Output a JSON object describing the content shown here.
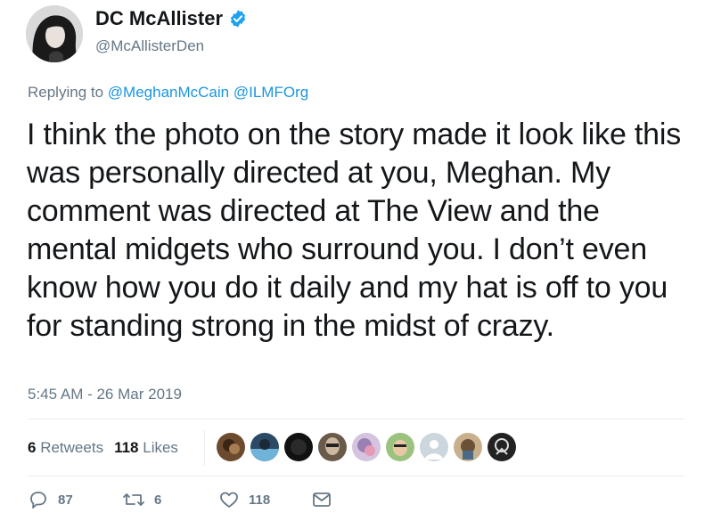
{
  "author": {
    "display_name": "DC McAllister",
    "handle": "@McAllisterDen",
    "verified": true
  },
  "reply": {
    "prefix": "Replying to",
    "mentions": [
      "@MeghanMcCain",
      "@ILMFOrg"
    ]
  },
  "tweet": {
    "text": "I think the photo on the story made it look like this was personally directed at you, Meghan. My comment was directed at The View and the mental midgets who surround you. I don’t even know how you do it daily and my hat is off to you for standing strong in the midst of crazy.",
    "timestamp": "5:45 AM - 26 Mar 2019"
  },
  "stats": {
    "retweets_count": "6",
    "retweets_label": "Retweets",
    "likes_count": "118",
    "likes_label": "Likes"
  },
  "liker_avatars": [
    {
      "icon": "liker-avatar-1",
      "color": "#6b4a2e"
    },
    {
      "icon": "liker-avatar-2",
      "color": "#4a7fa8"
    },
    {
      "icon": "liker-avatar-3",
      "color": "#111111"
    },
    {
      "icon": "liker-avatar-4",
      "color": "#8a7a6a"
    },
    {
      "icon": "liker-avatar-5",
      "color": "#b9a3c9"
    },
    {
      "icon": "liker-avatar-6",
      "color": "#7fa56a"
    },
    {
      "icon": "liker-avatar-default",
      "color": "#ccd6dd"
    },
    {
      "icon": "liker-avatar-8",
      "color": "#a38b6d"
    },
    {
      "icon": "liker-avatar-9",
      "color": "#222222"
    }
  ],
  "actions": {
    "reply_count": "87",
    "retweet_count": "6",
    "like_count": "118"
  },
  "colors": {
    "text": "#14171a",
    "muted": "#657786",
    "link": "#1b95e0",
    "verified": "#1da1f2",
    "divider": "#e6ecf0"
  }
}
